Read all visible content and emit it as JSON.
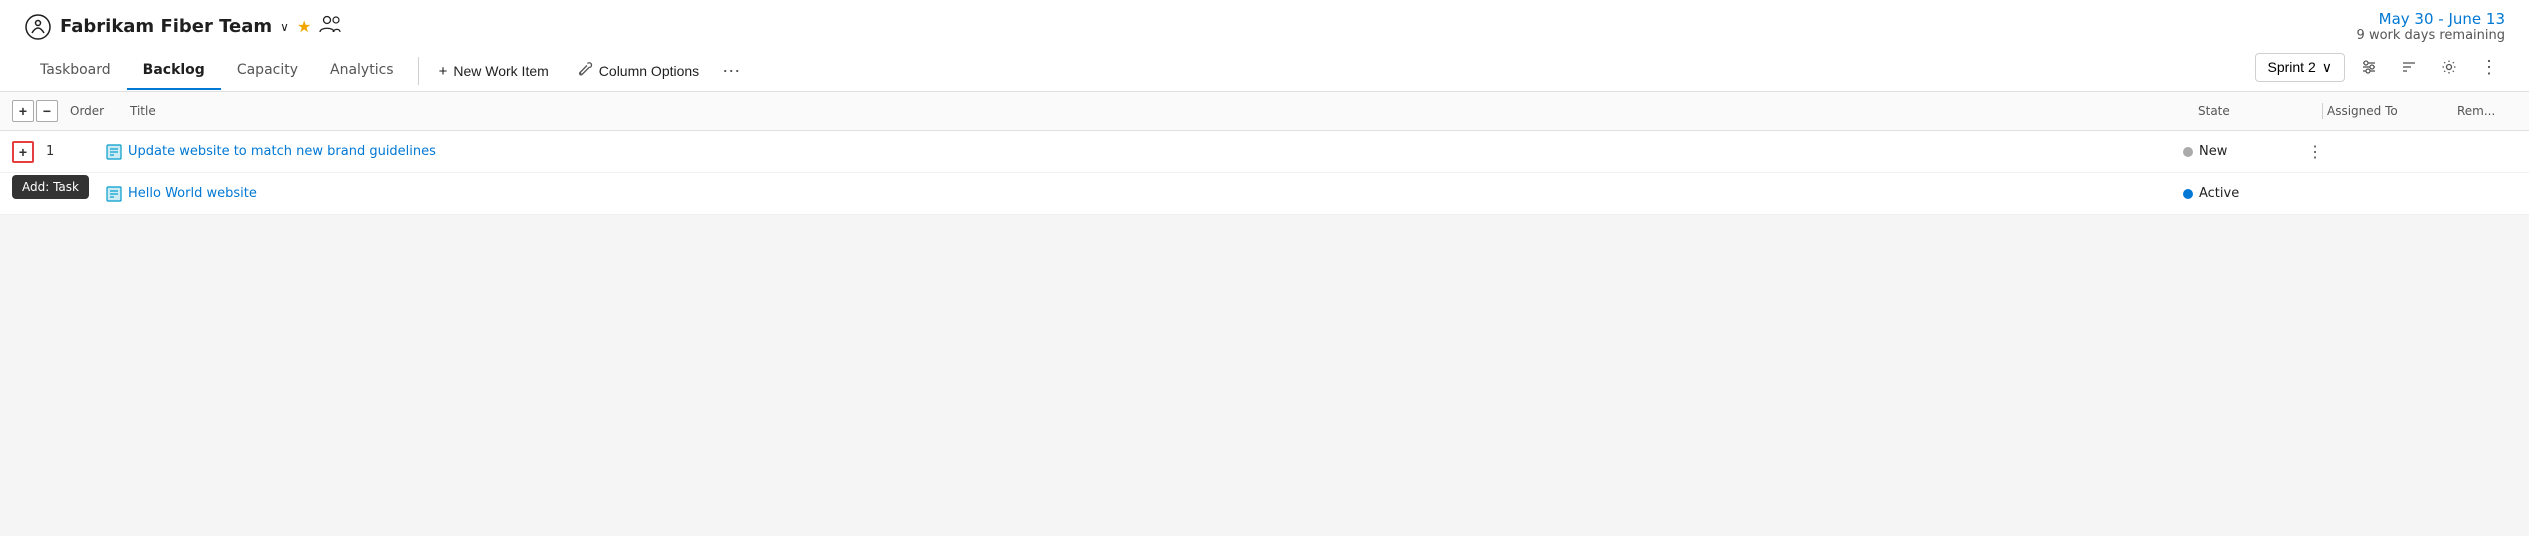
{
  "team": {
    "name": "Fabrikam Fiber Team",
    "chevron": "∨",
    "star": "★",
    "people_icon": "⛟"
  },
  "sprint": {
    "dates": "May 30 - June 13",
    "days_remaining": "9 work days remaining",
    "current": "Sprint 2"
  },
  "nav": {
    "tabs": [
      {
        "id": "taskboard",
        "label": "Taskboard",
        "active": false
      },
      {
        "id": "backlog",
        "label": "Backlog",
        "active": true
      },
      {
        "id": "capacity",
        "label": "Capacity",
        "active": false
      },
      {
        "id": "analytics",
        "label": "Analytics",
        "active": false
      }
    ]
  },
  "toolbar": {
    "new_work_item": "New Work Item",
    "column_options": "Column Options",
    "more_label": "⋯"
  },
  "table": {
    "columns": {
      "order": "Order",
      "title": "Title",
      "state": "State",
      "assigned_to": "Assigned To",
      "remaining": "Rem..."
    },
    "rows": [
      {
        "order": "1",
        "title": "Update website to match new brand guidelines",
        "state": "New",
        "state_type": "new",
        "assigned_to": "",
        "remaining": ""
      },
      {
        "order": "",
        "title": "Hello World website",
        "state": "Active",
        "state_type": "active",
        "assigned_to": "",
        "remaining": ""
      }
    ]
  },
  "tooltip": {
    "add_task": "Add: Task"
  },
  "icons": {
    "plus": "+",
    "minus": "−",
    "expand_plus": "+",
    "wrench": "🔧",
    "filter": "≡",
    "settings": "⚙",
    "more_vert": "⋮",
    "chevron_down": "∨"
  }
}
